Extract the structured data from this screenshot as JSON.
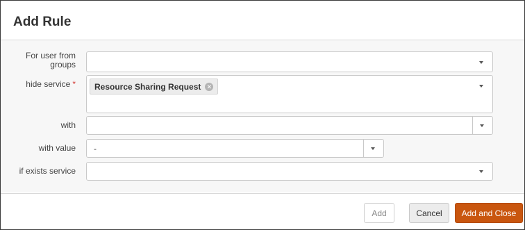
{
  "dialog": {
    "title": "Add Rule"
  },
  "form": {
    "user_groups_label": "For user from groups",
    "hide_service_label": "hide service",
    "required_marker": "*",
    "hide_service_chip": "Resource Sharing Request",
    "with_label": "with",
    "with_value_label": "with value",
    "with_value_value": "-",
    "if_exists_label": "if exists service"
  },
  "footer": {
    "add_label": "Add",
    "cancel_label": "Cancel",
    "add_close_label": "Add and Close"
  },
  "colors": {
    "primary_button": "#c9560f",
    "required": "#d43f3a"
  }
}
